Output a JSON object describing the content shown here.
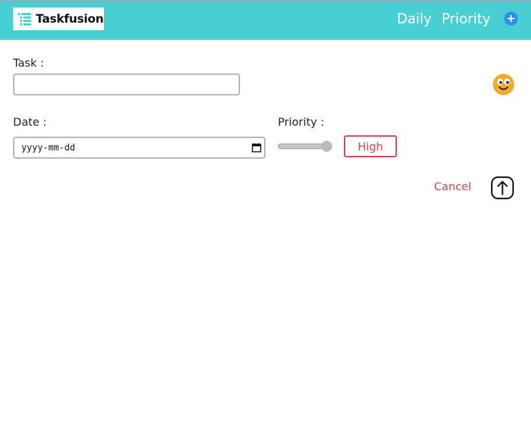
{
  "app": {
    "name": "Taskfusion"
  },
  "nav": {
    "daily": "Daily",
    "priority": "Priority"
  },
  "form": {
    "task_label": "Task :",
    "task_value": "",
    "date_label": "Date :",
    "date_placeholder": "yyyy-mm-dd",
    "priority_label": "Priority :",
    "priority_level": 1.0,
    "priority_value": "High",
    "cancel_label": "Cancel"
  },
  "icons": {
    "logo": "list-icon",
    "add": "plus-circle-icon",
    "emoji": "smiley-face-icon",
    "calendar": "calendar-icon",
    "submit": "upload-arrow-icon"
  },
  "colors": {
    "header": "#48cfd2",
    "accent": "#c9474c",
    "add_button": "#2f8ff0",
    "emoji": "#f6a92c"
  }
}
